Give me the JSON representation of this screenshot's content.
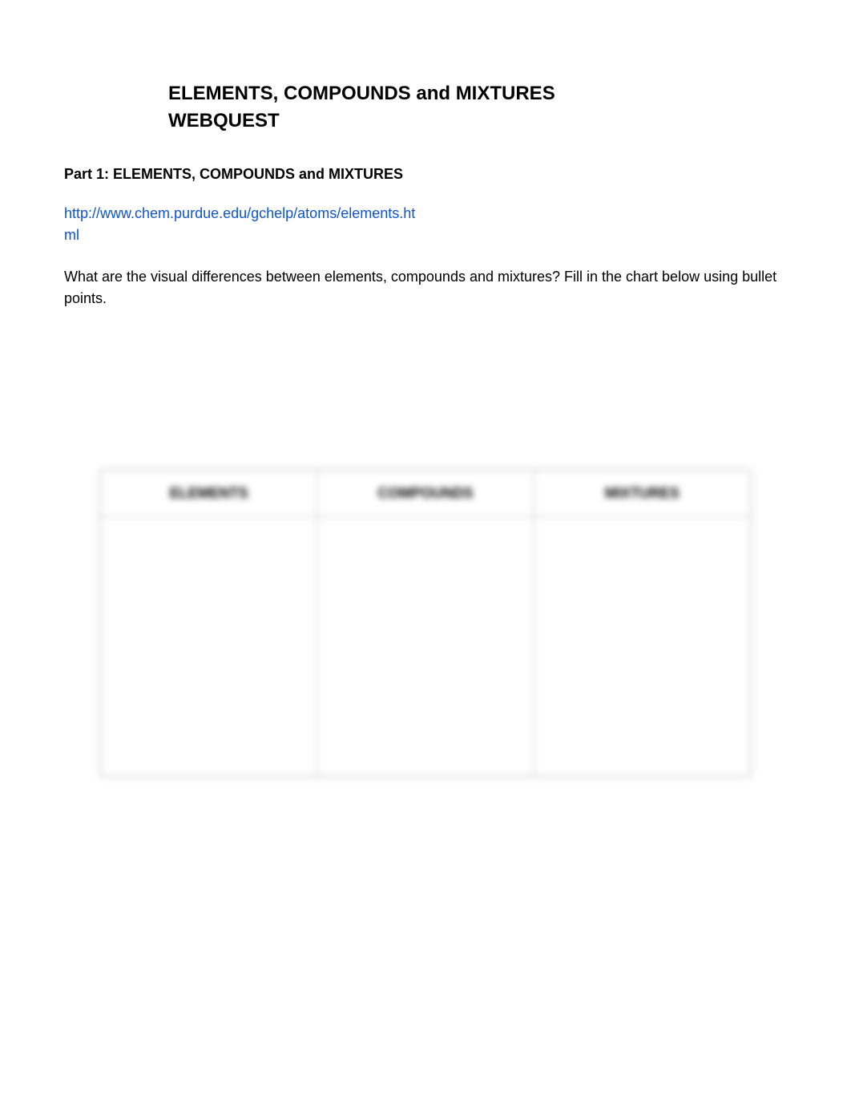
{
  "title": "ELEMENTS, COMPOUNDS and MIXTURES WEBQUEST",
  "part1": {
    "heading": "Part 1: ELEMENTS, COMPOUNDS and MIXTURES",
    "url": "http://www.chem.purdue.edu/gchelp/atoms/elements.html",
    "prompt": "What are the visual differences between elements, compounds and mixtures? Fill in the chart below using bullet points."
  },
  "table": {
    "headers": [
      "ELEMENTS",
      "COMPOUNDS",
      "MIXTURES"
    ]
  }
}
